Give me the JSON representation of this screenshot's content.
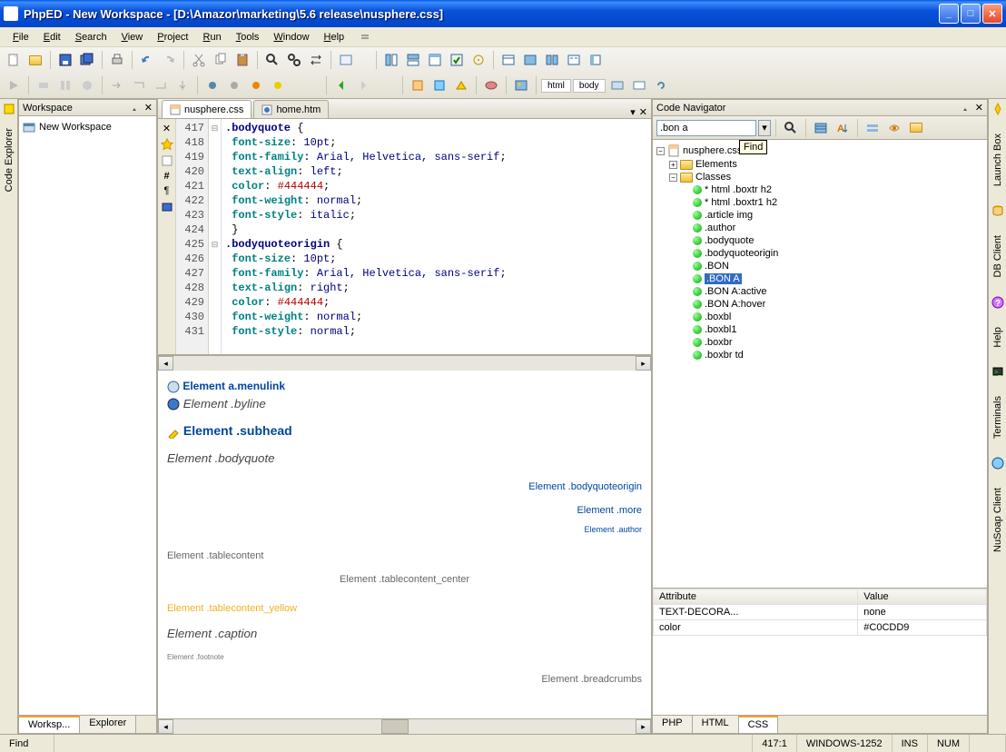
{
  "title": "PhpED - New Workspace - [D:\\Amazor\\marketing\\5.6 release\\nusphere.css]",
  "menus": [
    "File",
    "Edit",
    "Search",
    "View",
    "Project",
    "Run",
    "Tools",
    "Window",
    "Help"
  ],
  "workspace": {
    "title": "Workspace",
    "root": "New Workspace"
  },
  "leftVTab": "Code Explorer",
  "editorTabs": [
    {
      "label": "nusphere.css",
      "active": true
    },
    {
      "label": "home.htm",
      "active": false
    }
  ],
  "lineNumbers": [
    "417",
    "418",
    "419",
    "420",
    "421",
    "422",
    "423",
    "424",
    "425",
    "426",
    "427",
    "428",
    "429",
    "430",
    "431"
  ],
  "code": {
    "l417_s": ".bodyquote",
    "l417_b": " {",
    "l418_k": "font-size",
    "l418_v": "10pt",
    "l419_k": "font-family",
    "l419_v": "Arial, Helvetica, sans-serif",
    "l420_k": "text-align",
    "l420_v": "left",
    "l421_k": "color",
    "l421_v": "#444444",
    "l422_k": "font-weight",
    "l422_v": "normal",
    "l423_k": "font-style",
    "l423_v": "italic",
    "l424": "}",
    "l425_s": ".bodyquoteorigin",
    "l425_b": " {",
    "l426_k": "font-size",
    "l426_v": "10pt",
    "l427_k": "font-family",
    "l427_v": "Arial, Helvetica, sans-serif",
    "l428_k": "text-align",
    "l428_v": "right",
    "l429_k": "color",
    "l429_v": "#444444",
    "l430_k": "font-weight",
    "l430_v": "normal",
    "l431_k": "font-style",
    "l431_v": "normal"
  },
  "preview": {
    "menulink": "Element a.menulink",
    "byline": "Element .byline",
    "subhead": "Element .subhead",
    "bodyquote": "Element .bodyquote",
    "bodyquoteorigin": "Element .bodyquoteorigin",
    "more": "Element .more",
    "author": "Element .author",
    "tablecontent": "Element .tablecontent",
    "tablecontent_center": "Element .tablecontent_center",
    "tablecontent_yellow": "Element .tablecontent_yellow",
    "caption": "Element .caption",
    "footnote": "Element .footnote",
    "breadcrumbs": "Element .breadcrumbs"
  },
  "breadcrumbs": [
    "html",
    "body"
  ],
  "navigator": {
    "title": "Code Navigator",
    "search": ".bon a",
    "tooltip": "Find",
    "file": "nusphere.css",
    "folders": {
      "elements": "Elements",
      "classes": "Classes"
    },
    "classes": [
      "* html .boxtr h2",
      "* html .boxtr1 h2",
      ".article img",
      ".author",
      ".bodyquote",
      ".bodyquoteorigin",
      ".BON",
      ".BON A",
      ".BON A:active",
      ".BON A:hover",
      ".boxbl",
      ".boxbl1",
      ".boxbr",
      ".boxbr td"
    ],
    "selectedIndex": 7
  },
  "attributes": {
    "headers": {
      "attr": "Attribute",
      "val": "Value"
    },
    "rows": [
      {
        "attr": "TEXT-DECORA...",
        "val": "none"
      },
      {
        "attr": "color",
        "val": "#C0CDD9"
      }
    ]
  },
  "navBottomTabs": [
    "PHP",
    "HTML",
    "CSS"
  ],
  "wsBottomTabs": [
    "Worksp...",
    "Explorer"
  ],
  "rightVTabs": [
    "Launch Box",
    "DB Client",
    "Help",
    "Terminals",
    "NuSoap Client"
  ],
  "status": {
    "find": "Find",
    "pos": "417:1",
    "enc": "WINDOWS-1252",
    "ins": "INS",
    "num": "NUM"
  }
}
